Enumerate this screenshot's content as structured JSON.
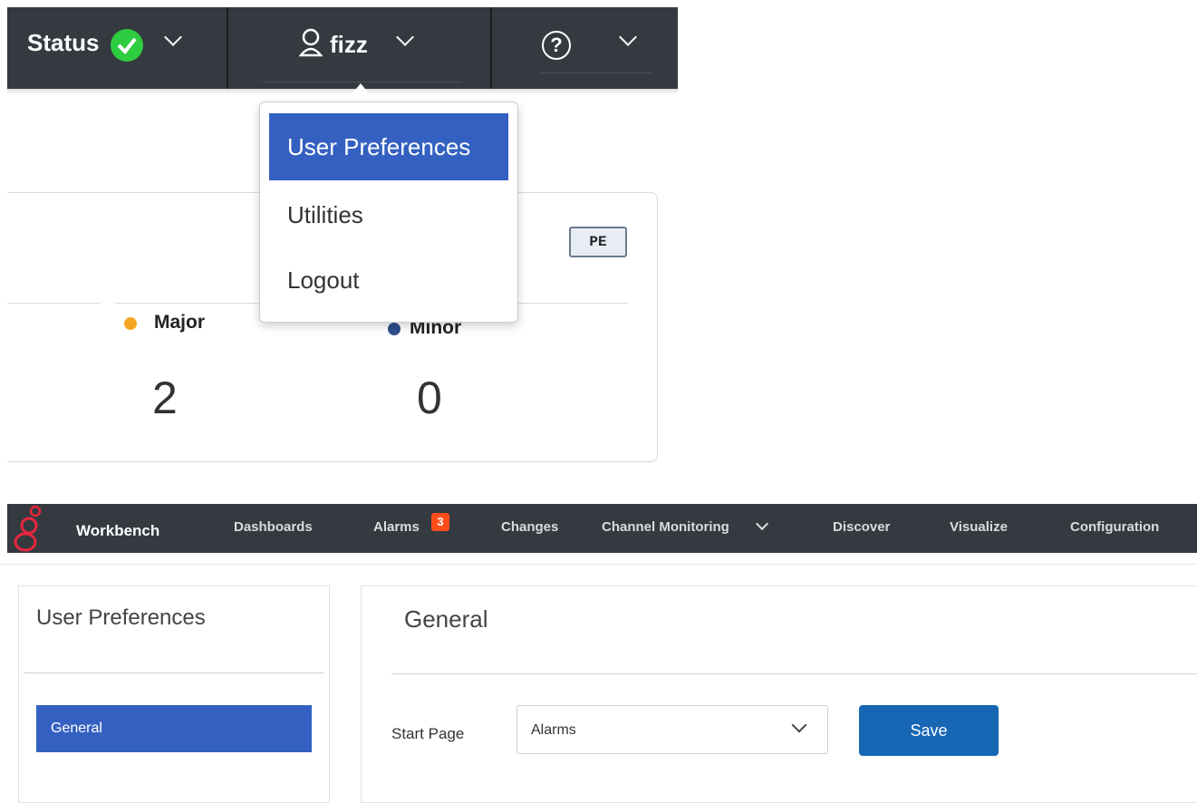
{
  "top_header": {
    "status_label": "Status",
    "user_name": "fizz",
    "help_glyph": "?"
  },
  "user_menu": {
    "items": [
      {
        "label": "User Preferences",
        "selected": true
      },
      {
        "label": "Utilities"
      },
      {
        "label": "Logout"
      }
    ]
  },
  "summary_card": {
    "badge": "PE",
    "major_label": "Major",
    "minor_label": "Minor",
    "major_count": "2",
    "minor_count": "0",
    "major_color": "#f5a623",
    "minor_color": "#2f4f8c"
  },
  "nav": {
    "brand": "Workbench",
    "items": [
      "Dashboards",
      "Alarms",
      "Changes",
      "Channel Monitoring",
      "Discover",
      "Visualize",
      "Configuration"
    ],
    "alarms_count": "3"
  },
  "preferences": {
    "sidebar_title": "User Preferences",
    "sidebar_items": [
      "General"
    ],
    "section_title": "General",
    "start_page_label": "Start Page",
    "start_page_value": "Alarms",
    "save_label": "Save"
  },
  "colors": {
    "header_bg": "#343a40",
    "accent": "#3461c1",
    "save_button": "#1666b4",
    "status_ok": "#2ecc40",
    "alarm_badge": "#ff4d1a"
  },
  "icons": [
    "check-circle-icon",
    "user-icon",
    "help-circle-icon",
    "chevron-down-icon",
    "brand-logo-icon"
  ]
}
